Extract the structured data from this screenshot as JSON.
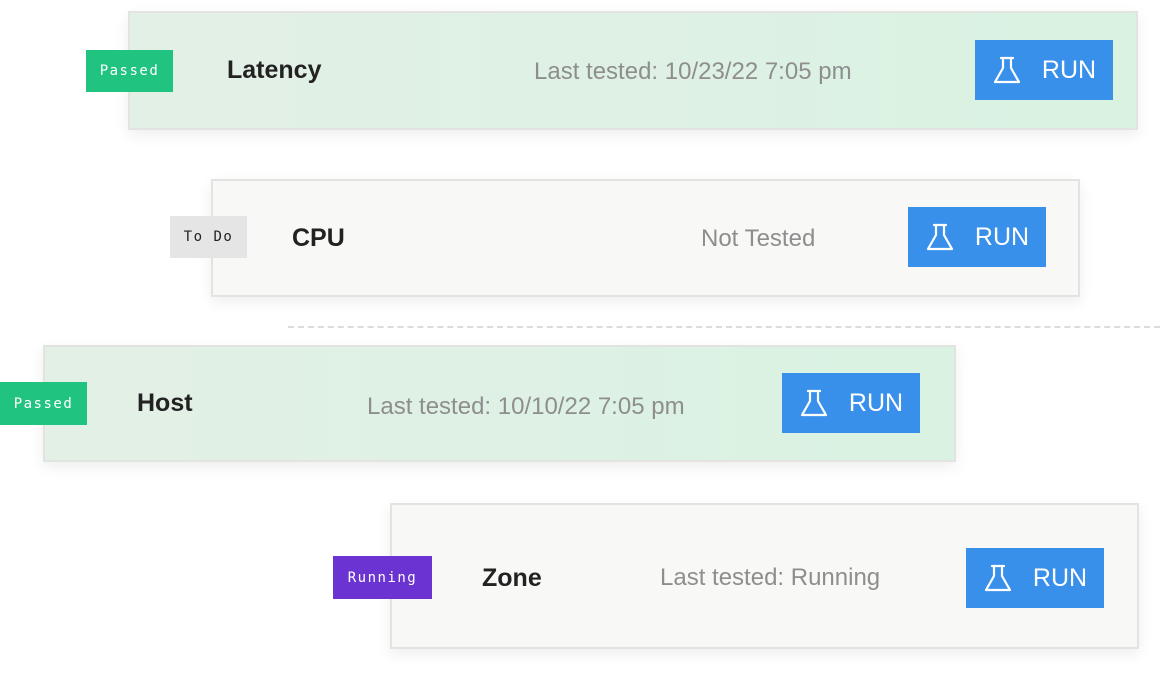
{
  "tests": [
    {
      "badge": "Passed",
      "badge_color": "#21c381",
      "name": "Latency",
      "status": "Last tested: 10/23/22 7:05 pm",
      "run_label": "RUN",
      "run_icon": "flask-icon"
    },
    {
      "badge": "To Do",
      "badge_color": "#e5e5e5",
      "name": "CPU",
      "status": "Not Tested",
      "run_label": "RUN",
      "run_icon": "flask-icon"
    },
    {
      "badge": "Passed",
      "badge_color": "#21c381",
      "name": "Host",
      "status": "Last tested: 10/10/22 7:05 pm",
      "run_label": "RUN",
      "run_icon": "flask-icon"
    },
    {
      "badge": "Running",
      "badge_color": "#6b34d2",
      "name": "Zone",
      "status": "Last tested: Running",
      "run_label": "RUN",
      "run_icon": "flask-icon"
    }
  ],
  "colors": {
    "passed_card": "#dff1e5",
    "neutral_card": "#f8f8f6",
    "run_button": "#3890ea",
    "status_text": "#8e8e8e"
  }
}
